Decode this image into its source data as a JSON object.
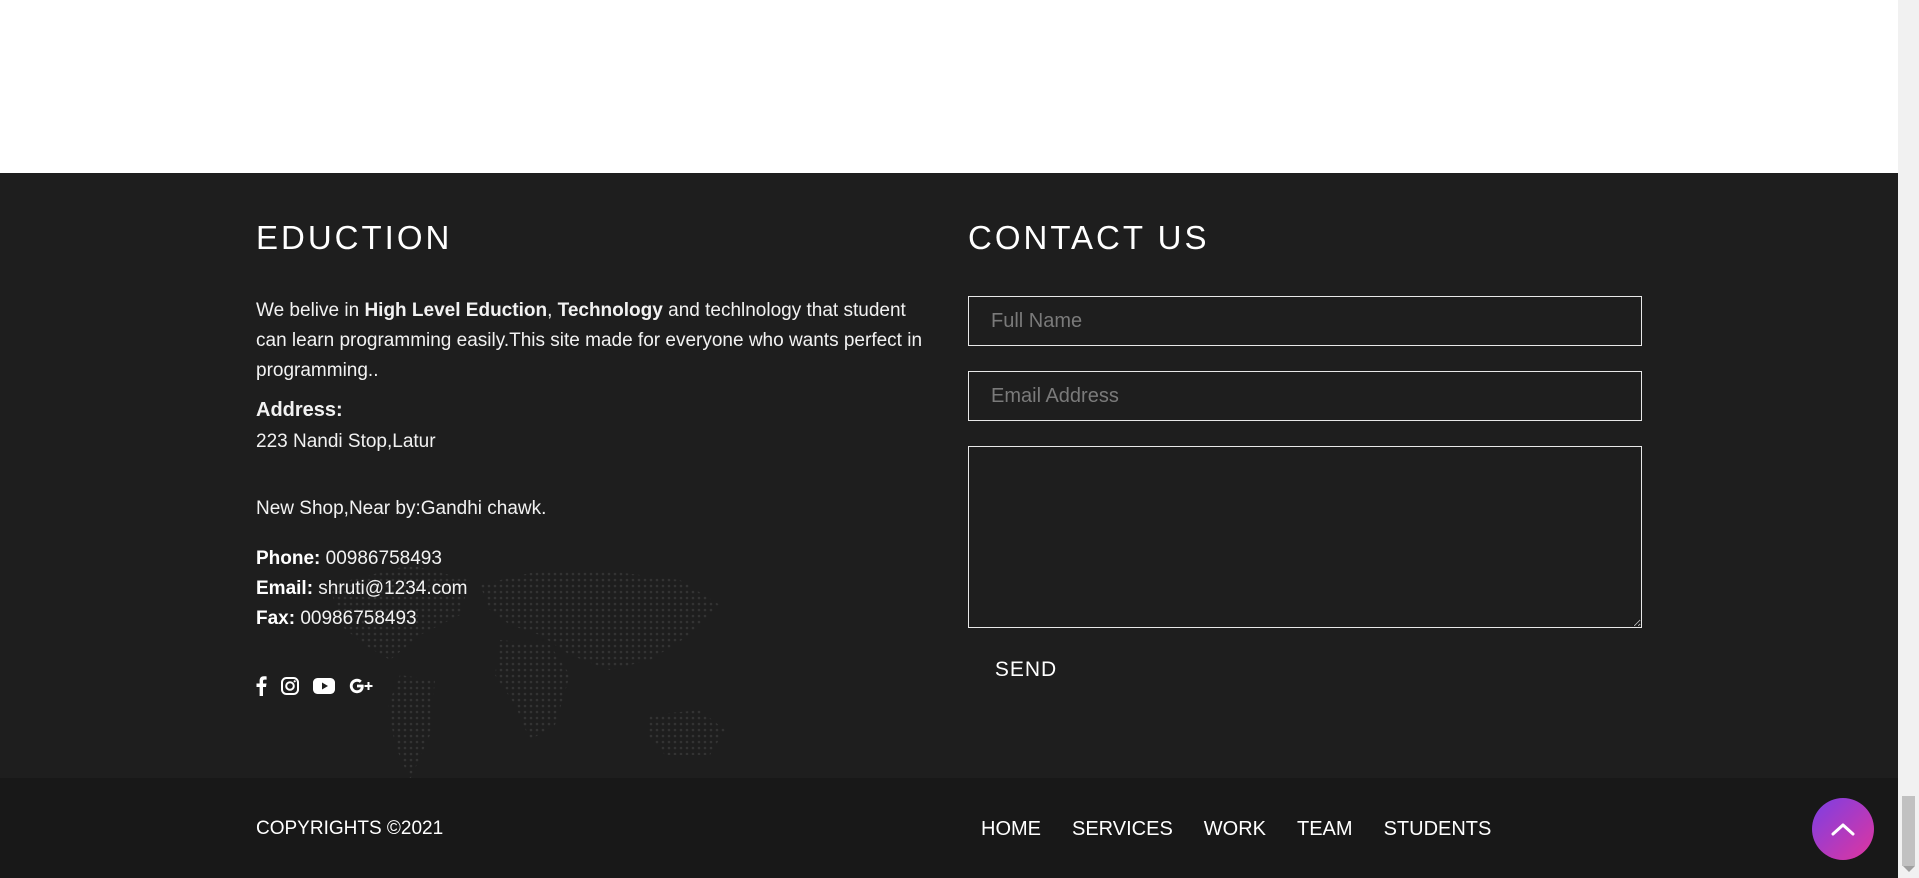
{
  "left": {
    "heading": "EDUCTION",
    "about_prefix": "We belive in ",
    "about_bold1": "High Level Eduction",
    "about_comma": ", ",
    "about_bold2": "Technology",
    "about_suffix": " and techlnology that student can learn programming easily.This site made for everyone who wants perfect in programming..",
    "address_label": "Address:",
    "address_line1": "223 Nandi Stop,Latur",
    "address_line2": "New Shop,Near by:Gandhi chawk.",
    "phone_label": "Phone:",
    "phone_value": " 00986758493",
    "email_label": "Email:",
    "email_value": " shruti@1234.com",
    "fax_label": "Fax:",
    "fax_value": " 00986758493"
  },
  "social": {
    "icons": [
      "facebook-icon",
      "instagram-icon",
      "youtube-icon",
      "google-plus-icon"
    ]
  },
  "contact": {
    "heading": "CONTACT US",
    "name_placeholder": "Full Name",
    "email_placeholder": "Email Address",
    "message_placeholder": "",
    "send_label": "SEND"
  },
  "bottom": {
    "copyright": "COPYRIGHTS ©2021",
    "nav": [
      "HOME",
      "SERVICES",
      "WORK",
      "TEAM",
      "STUDENTS"
    ]
  },
  "colors": {
    "footer_bg": "#1e1e1e",
    "footer_bottom_bg": "#181818",
    "accent_gradient_start": "#7b3fe4",
    "accent_gradient_end": "#e0359e"
  }
}
